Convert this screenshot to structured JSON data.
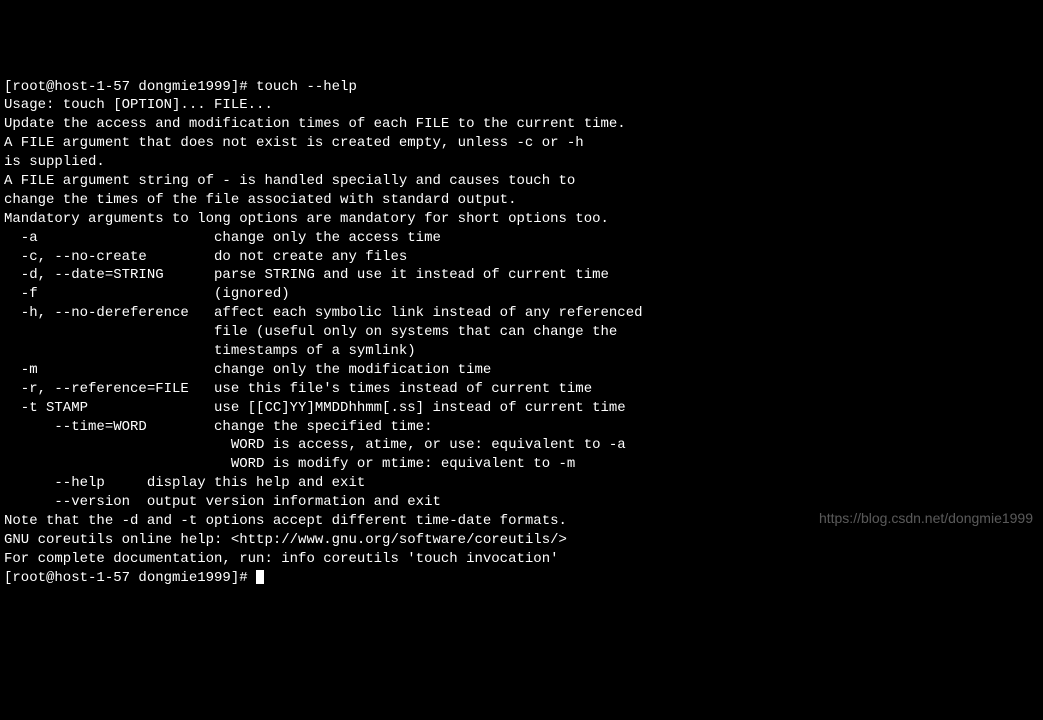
{
  "prompt1": {
    "full": "[root@host-1-57 dongmie1999]# ",
    "command": "touch --help"
  },
  "output": {
    "l01": "Usage: touch [OPTION]... FILE...",
    "l02": "Update the access and modification times of each FILE to the current time.",
    "l03": "",
    "l04": "A FILE argument that does not exist is created empty, unless -c or -h",
    "l05": "is supplied.",
    "l06": "",
    "l07": "A FILE argument string of - is handled specially and causes touch to",
    "l08": "change the times of the file associated with standard output.",
    "l09": "",
    "l10": "Mandatory arguments to long options are mandatory for short options too.",
    "l11": "  -a                     change only the access time",
    "l12": "  -c, --no-create        do not create any files",
    "l13": "  -d, --date=STRING      parse STRING and use it instead of current time",
    "l14": "  -f                     (ignored)",
    "l15": "  -h, --no-dereference   affect each symbolic link instead of any referenced",
    "l16": "                         file (useful only on systems that can change the",
    "l17": "                         timestamps of a symlink)",
    "l18": "  -m                     change only the modification time",
    "l19": "  -r, --reference=FILE   use this file's times instead of current time",
    "l20": "  -t STAMP               use [[CC]YY]MMDDhhmm[.ss] instead of current time",
    "l21": "      --time=WORD        change the specified time:",
    "l22": "                           WORD is access, atime, or use: equivalent to -a",
    "l23": "                           WORD is modify or mtime: equivalent to -m",
    "l24": "      --help     display this help and exit",
    "l25": "      --version  output version information and exit",
    "l26": "",
    "l27": "Note that the -d and -t options accept different time-date formats.",
    "l28": "",
    "l29": "GNU coreutils online help: <http://www.gnu.org/software/coreutils/>",
    "l30": "For complete documentation, run: info coreutils 'touch invocation'"
  },
  "prompt2": {
    "full": "[root@host-1-57 dongmie1999]# "
  },
  "watermark": "https://blog.csdn.net/dongmie1999"
}
